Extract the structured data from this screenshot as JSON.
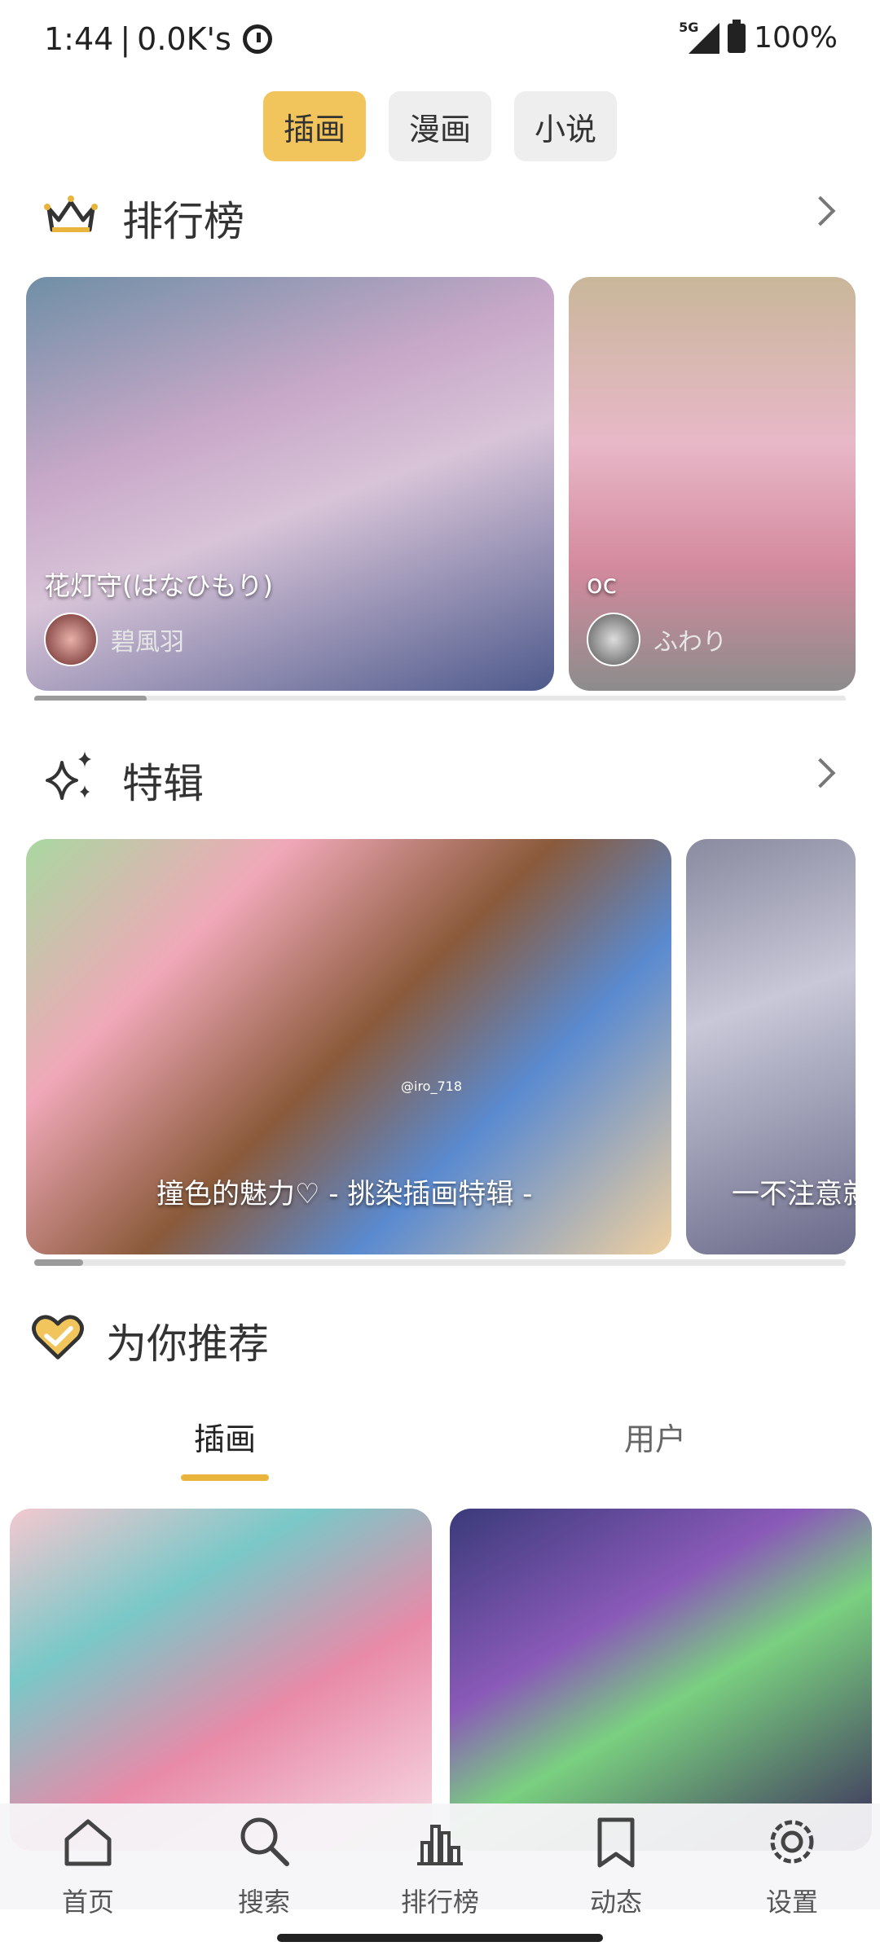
{
  "status": {
    "time": "1:44",
    "speed": "0.0K's",
    "network": "5G",
    "battery": "100%"
  },
  "content_tabs": [
    {
      "label": "插画"
    },
    {
      "label": "漫画"
    },
    {
      "label": "小说"
    }
  ],
  "ranking": {
    "title": "排行榜",
    "cards": [
      {
        "caption": "花灯守(はなひもり)",
        "author": "碧風羽"
      },
      {
        "caption": "oc",
        "author": "ふわり"
      }
    ]
  },
  "special": {
    "title": "特辑",
    "cards": [
      {
        "caption": "撞色的魅力♡ - 挑染插画特辑 -",
        "watermark": "@iro_718"
      },
      {
        "caption": "一不注意就"
      }
    ]
  },
  "recommend": {
    "title": "为你推荐",
    "tabs": [
      {
        "label": "插画"
      },
      {
        "label": "用户"
      }
    ]
  },
  "bottom_nav": [
    {
      "label": "首页",
      "icon": "home-icon"
    },
    {
      "label": "搜索",
      "icon": "search-icon"
    },
    {
      "label": "排行榜",
      "icon": "chart-icon"
    },
    {
      "label": "动态",
      "icon": "bookmark-icon"
    },
    {
      "label": "设置",
      "icon": "gear-icon"
    }
  ],
  "colors": {
    "accent": "#f2c55c",
    "indicator": "#e9b43c"
  }
}
